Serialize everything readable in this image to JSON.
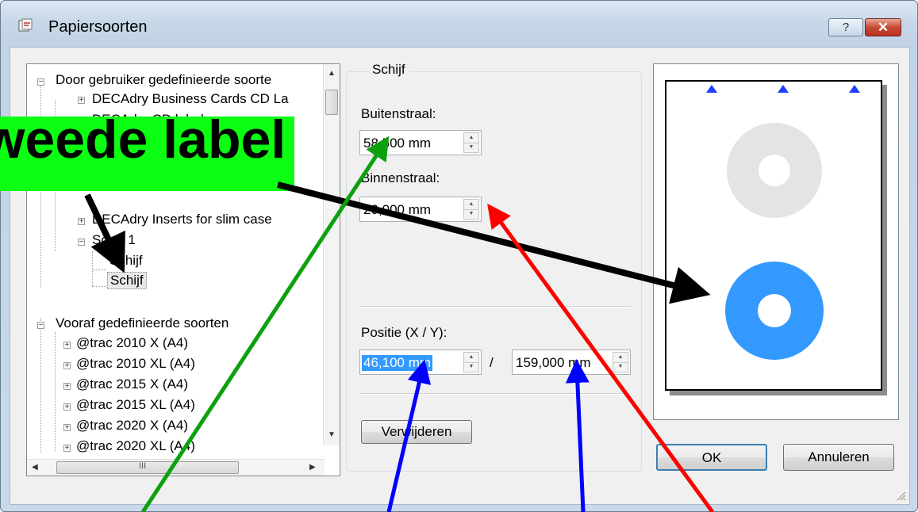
{
  "window": {
    "title": "Papiersoorten",
    "help_label": "?",
    "close_label": "✕"
  },
  "tree": {
    "items": [
      {
        "label": "Door gebruiker gedefinieerde soorte"
      },
      {
        "label": "DECAdry Business Cards CD La"
      },
      {
        "label": "DECAdry CD labels"
      },
      {
        "label": "DECAdry Inserts for slim case"
      },
      {
        "label": "Soort 1"
      },
      {
        "label": "Schijf"
      },
      {
        "label": "Schijf"
      },
      {
        "label": "Vooraf gedefinieerde soorten"
      },
      {
        "label": "@trac 2010 X (A4)"
      },
      {
        "label": "@trac 2010 XL (A4)"
      },
      {
        "label": "@trac 2015 X (A4)"
      },
      {
        "label": "@trac 2015 XL (A4)"
      },
      {
        "label": "@trac 2020 X (A4)"
      },
      {
        "label": "@trac 2020 XL (A4)"
      }
    ],
    "hscroll_grip": "III"
  },
  "schijf": {
    "group_label": "Schijf",
    "buitenstraal_label": "Buitenstraal:",
    "buitenstraal_value": "58,500 mm",
    "binnenstraal_label": "Binnenstraal:",
    "binnenstraal_value": "20,000 mm",
    "positie_label": "Positie (X / Y):",
    "positie_x": "46,100 mm",
    "positie_sep": "/",
    "positie_y": "159,000 mm",
    "remove_label": "Verwijderen"
  },
  "buttons": {
    "ok": "OK",
    "cancel": "Annuleren"
  },
  "annotation": {
    "callout_text": "Tweede label"
  },
  "colors": {
    "disc_gray": "#e4e4e4",
    "disc_selected": "#3399ff",
    "arrow_green": "#0ca10c",
    "arrow_red": "#ff0000",
    "arrow_blue": "#0000ff",
    "arrow_black": "#000000",
    "callout_bg": "#0cff12"
  }
}
